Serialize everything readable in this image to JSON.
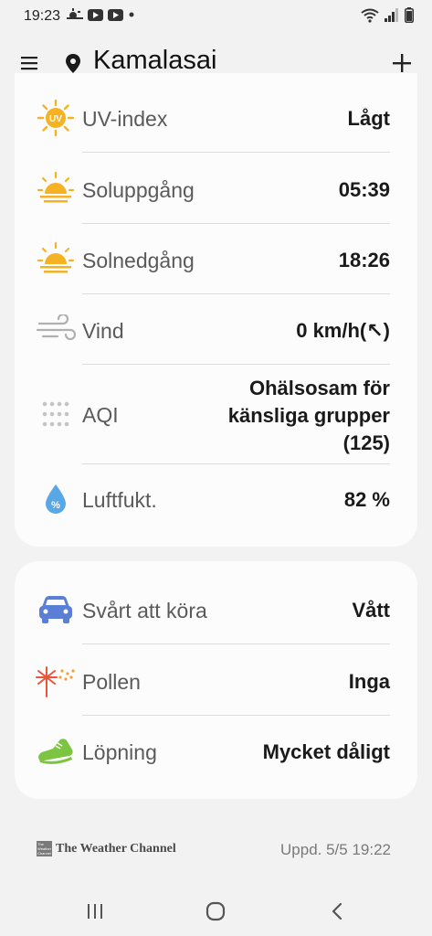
{
  "status_bar": {
    "time": "19:23",
    "left_icons": [
      "weather-icon",
      "youtube-icon",
      "youtube-icon",
      "dot-icon"
    ],
    "right_icons": [
      "wifi-icon",
      "signal-icon",
      "battery-icon"
    ]
  },
  "app_bar": {
    "city": "Kamalasai"
  },
  "details": [
    {
      "label": "UV-index",
      "value": "Lågt",
      "icon": "uv-icon"
    },
    {
      "label": "Soluppgång",
      "value": "05:39",
      "icon": "sunrise-icon"
    },
    {
      "label": "Solnedgång",
      "value": "18:26",
      "icon": "sunset-icon"
    },
    {
      "label": "Vind",
      "value": "0 km/h(↖︎)",
      "icon": "wind-icon"
    },
    {
      "label": "AQI",
      "value_lines": [
        "Ohälsosam för",
        "känsliga grupper",
        "(125)"
      ],
      "icon": "aqi-icon"
    },
    {
      "label": "Luftfukt.",
      "value": "82 %",
      "icon": "humidity-icon"
    }
  ],
  "activities": [
    {
      "label": "Svårt att köra",
      "value": "Vått",
      "icon": "car-icon"
    },
    {
      "label": "Pollen",
      "value": "Inga",
      "icon": "pollen-icon"
    },
    {
      "label": "Löpning",
      "value": "Mycket dåligt",
      "icon": "running-shoe-icon"
    }
  ],
  "footer": {
    "provider": "The Weather Channel",
    "updated": "Uppd. 5/5 19:22"
  },
  "colors": {
    "background": "#f2f2f2",
    "card": "#fcfcfc",
    "sun": "#f5b324",
    "car": "#5b7fd6",
    "humidity": "#5aa7e6",
    "shoe": "#7cc442",
    "pollen": "#e8553a"
  }
}
